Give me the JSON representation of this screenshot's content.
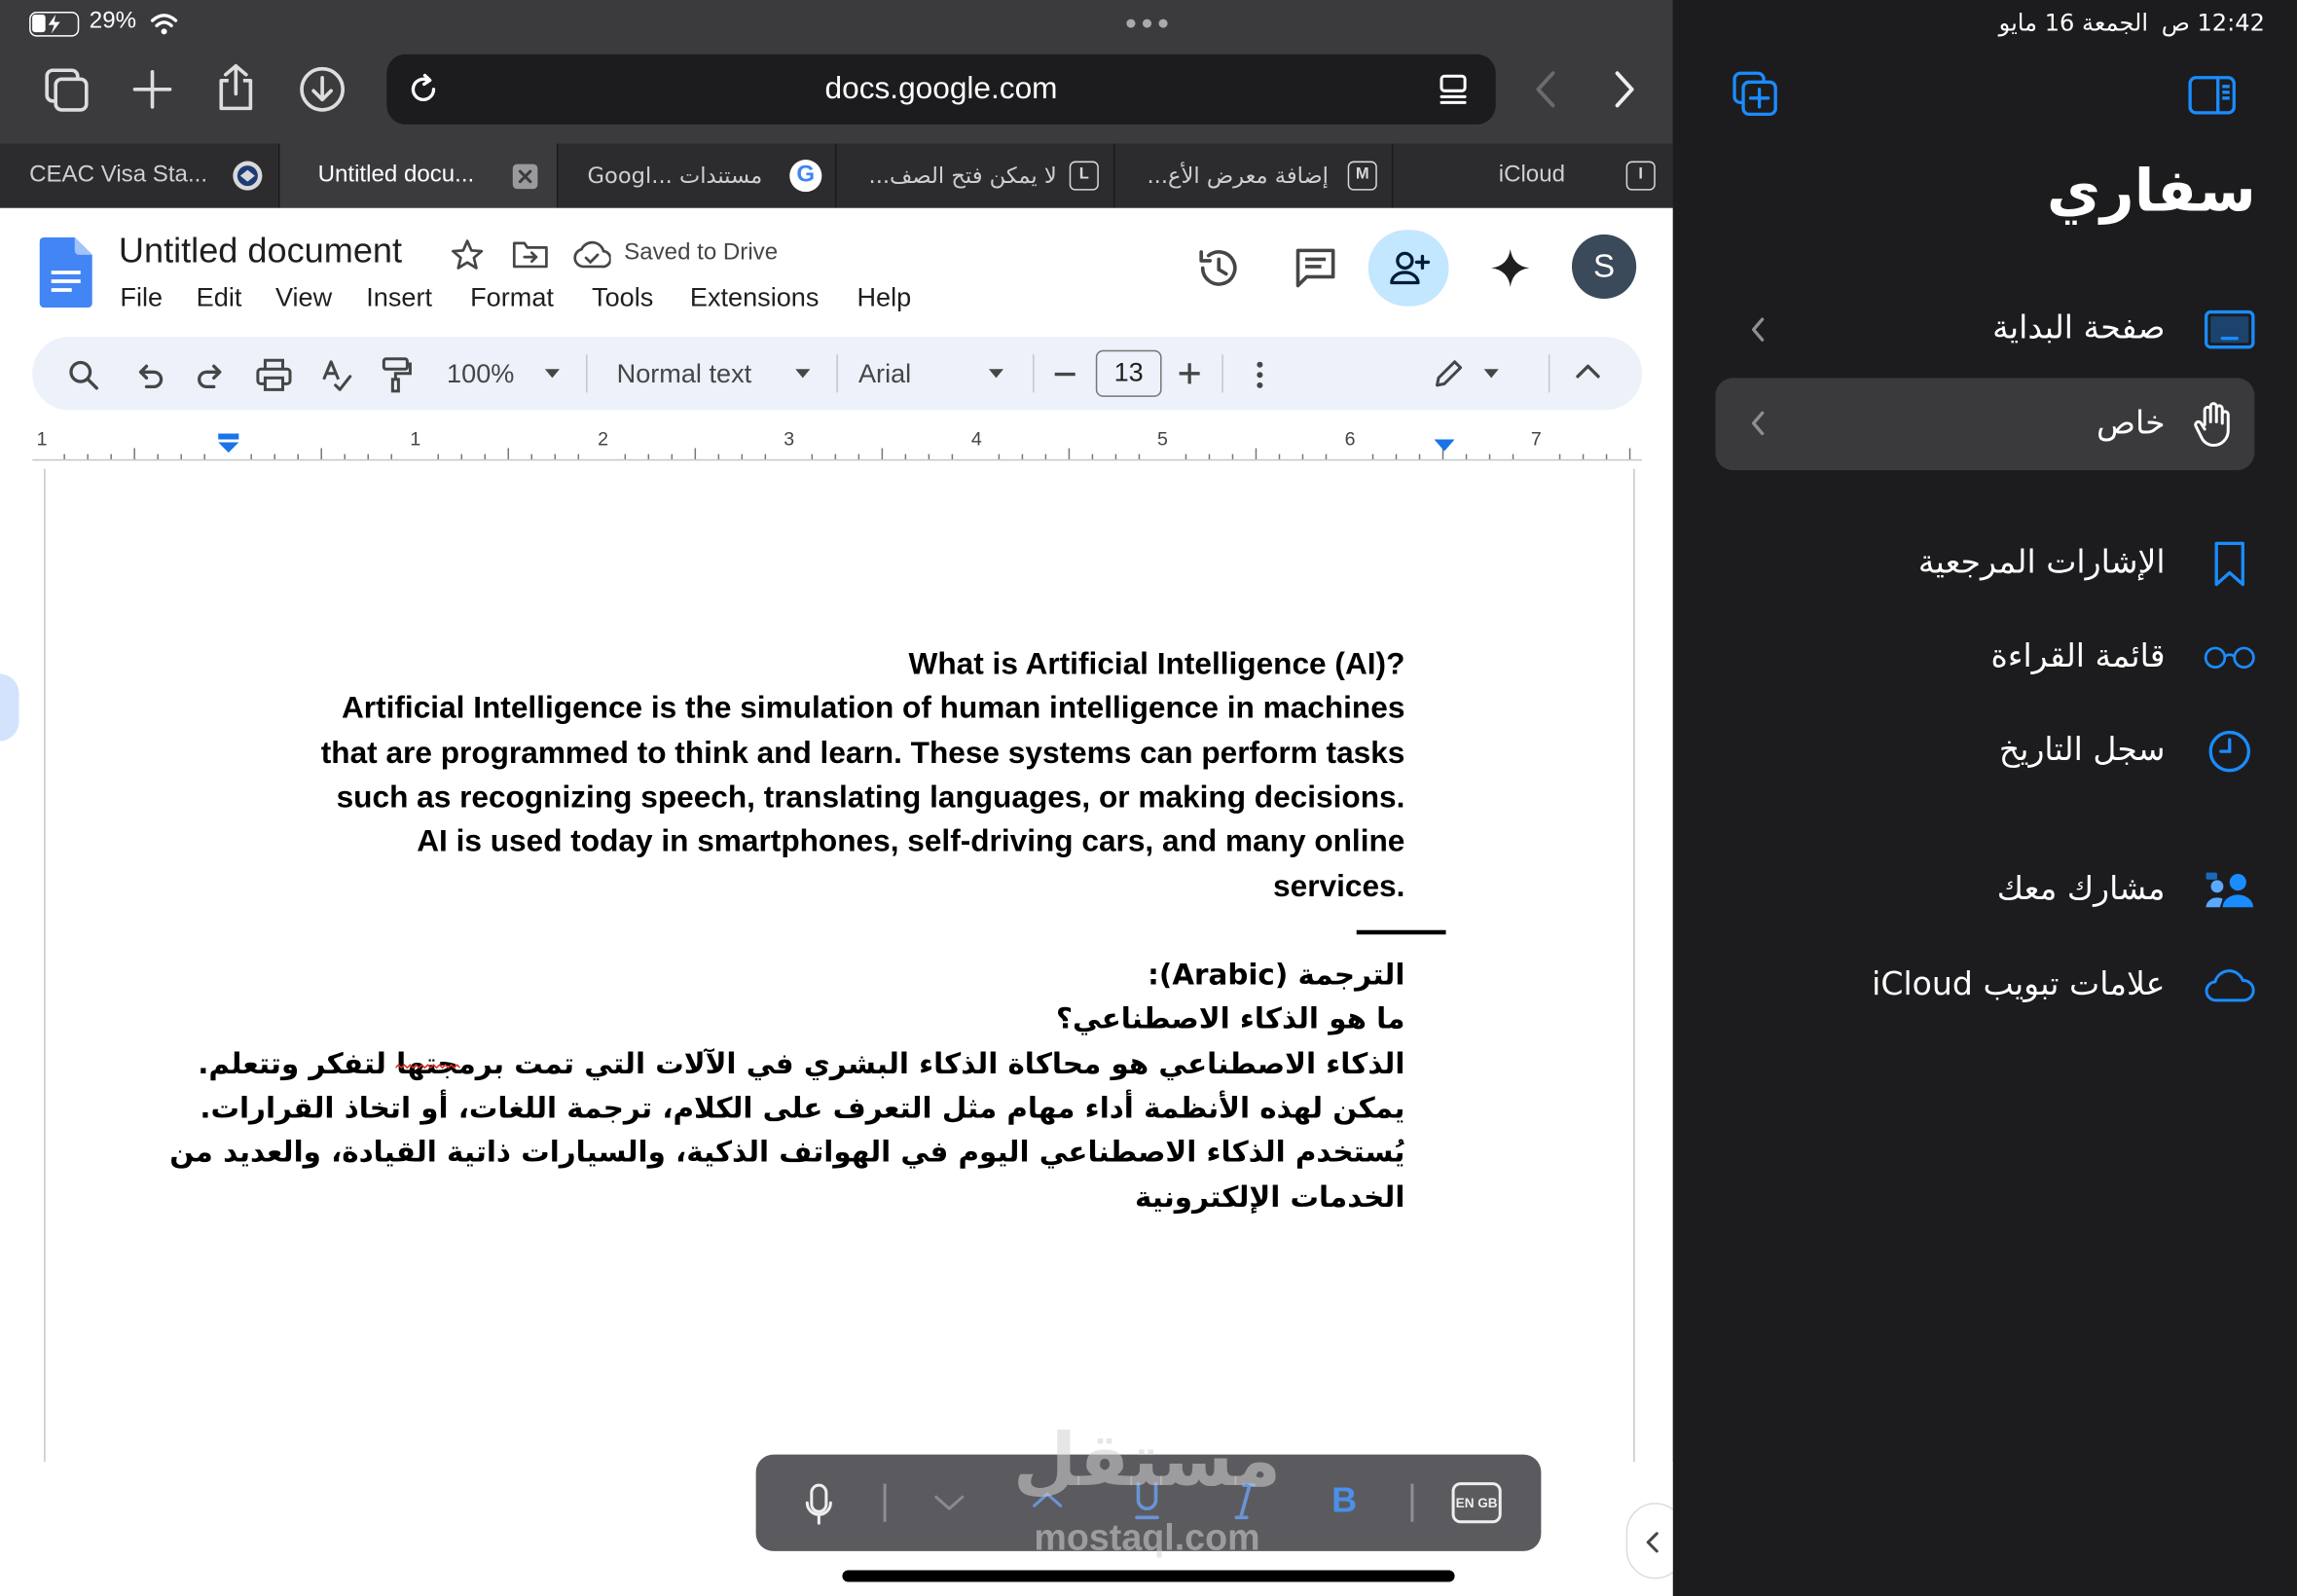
{
  "status": {
    "battery": "29%",
    "time": "12:42",
    "ampm": "ص",
    "date": "الجمعة 16 مايو"
  },
  "browser": {
    "url": "docs.google.com",
    "tabs": [
      {
        "title": "CEAC Visa Sta...",
        "favicon": "seal"
      },
      {
        "title": "Untitled docu...",
        "favicon": "close",
        "active": true
      },
      {
        "title": "مستندات ...Googl",
        "favicon": "G"
      },
      {
        "title": "لا يمكن فتح الصف...",
        "favicon": "L"
      },
      {
        "title": "إضافة معرض الأع...",
        "favicon": "M"
      },
      {
        "title": "iCloud",
        "favicon": "I"
      }
    ]
  },
  "docs": {
    "title": "Untitled document",
    "saved": "Saved to Drive",
    "avatar": "S",
    "menu": [
      "File",
      "Edit",
      "View",
      "Insert",
      "Format",
      "Tools",
      "Extensions",
      "Help"
    ],
    "toolbar": {
      "zoom": "100%",
      "style": "Normal text",
      "font": "Arial",
      "font_size": "13"
    },
    "ruler_numbers": [
      "1",
      "1",
      "2",
      "3",
      "4",
      "5",
      "6",
      "7"
    ],
    "content": {
      "heading": "What is Artificial Intelligence (AI)?",
      "english_lines": [
        "Artificial Intelligence is the simulation of human intelligence in machines",
        "that are programmed to think and learn. These systems can perform tasks",
        "such as recognizing speech, translating languages, or making decisions.",
        "AI is used today in smartphones, self-driving cars, and many online",
        "services."
      ],
      "translation_label": "الترجمة (Arabic):",
      "arabic_heading": "ما هو الذكاء الاصطناعي؟",
      "arabic_lines": [
        "الذكاء الاصطناعي هو محاكاة الذكاء البشري في الآلات التي تمت برمجتها لتفكر وتتعلم.",
        "يمكن لهذه الأنظمة أداء مهام مثل التعرف على الكلام، ترجمة اللغات، أو اتخاذ القرارات.",
        "يُستخدم الذكاء الاصطناعي اليوم في الهواتف الذكية، والسيارات ذاتية القيادة، والعديد من",
        "الخدمات الإلكترونية"
      ]
    }
  },
  "keyboard_bar": {
    "bold": "B",
    "lang": "EN GB"
  },
  "watermark": {
    "arabic": "مستقل",
    "latin": "mostaql.com"
  },
  "sidebar": {
    "title": "سفاري",
    "items": [
      {
        "label": "صفحة البداية",
        "icon": "start-page-icon"
      },
      {
        "label": "خاص",
        "icon": "hand-icon"
      },
      {
        "label": "الإشارات المرجعية",
        "icon": "bookmark-icon"
      },
      {
        "label": "قائمة القراءة",
        "icon": "glasses-icon"
      },
      {
        "label": "سجل التاريخ",
        "icon": "clock-icon"
      },
      {
        "label": "مشارك معك",
        "icon": "shared-icon"
      },
      {
        "label": "علامات تبويب iCloud",
        "icon": "cloud-icon"
      }
    ]
  }
}
